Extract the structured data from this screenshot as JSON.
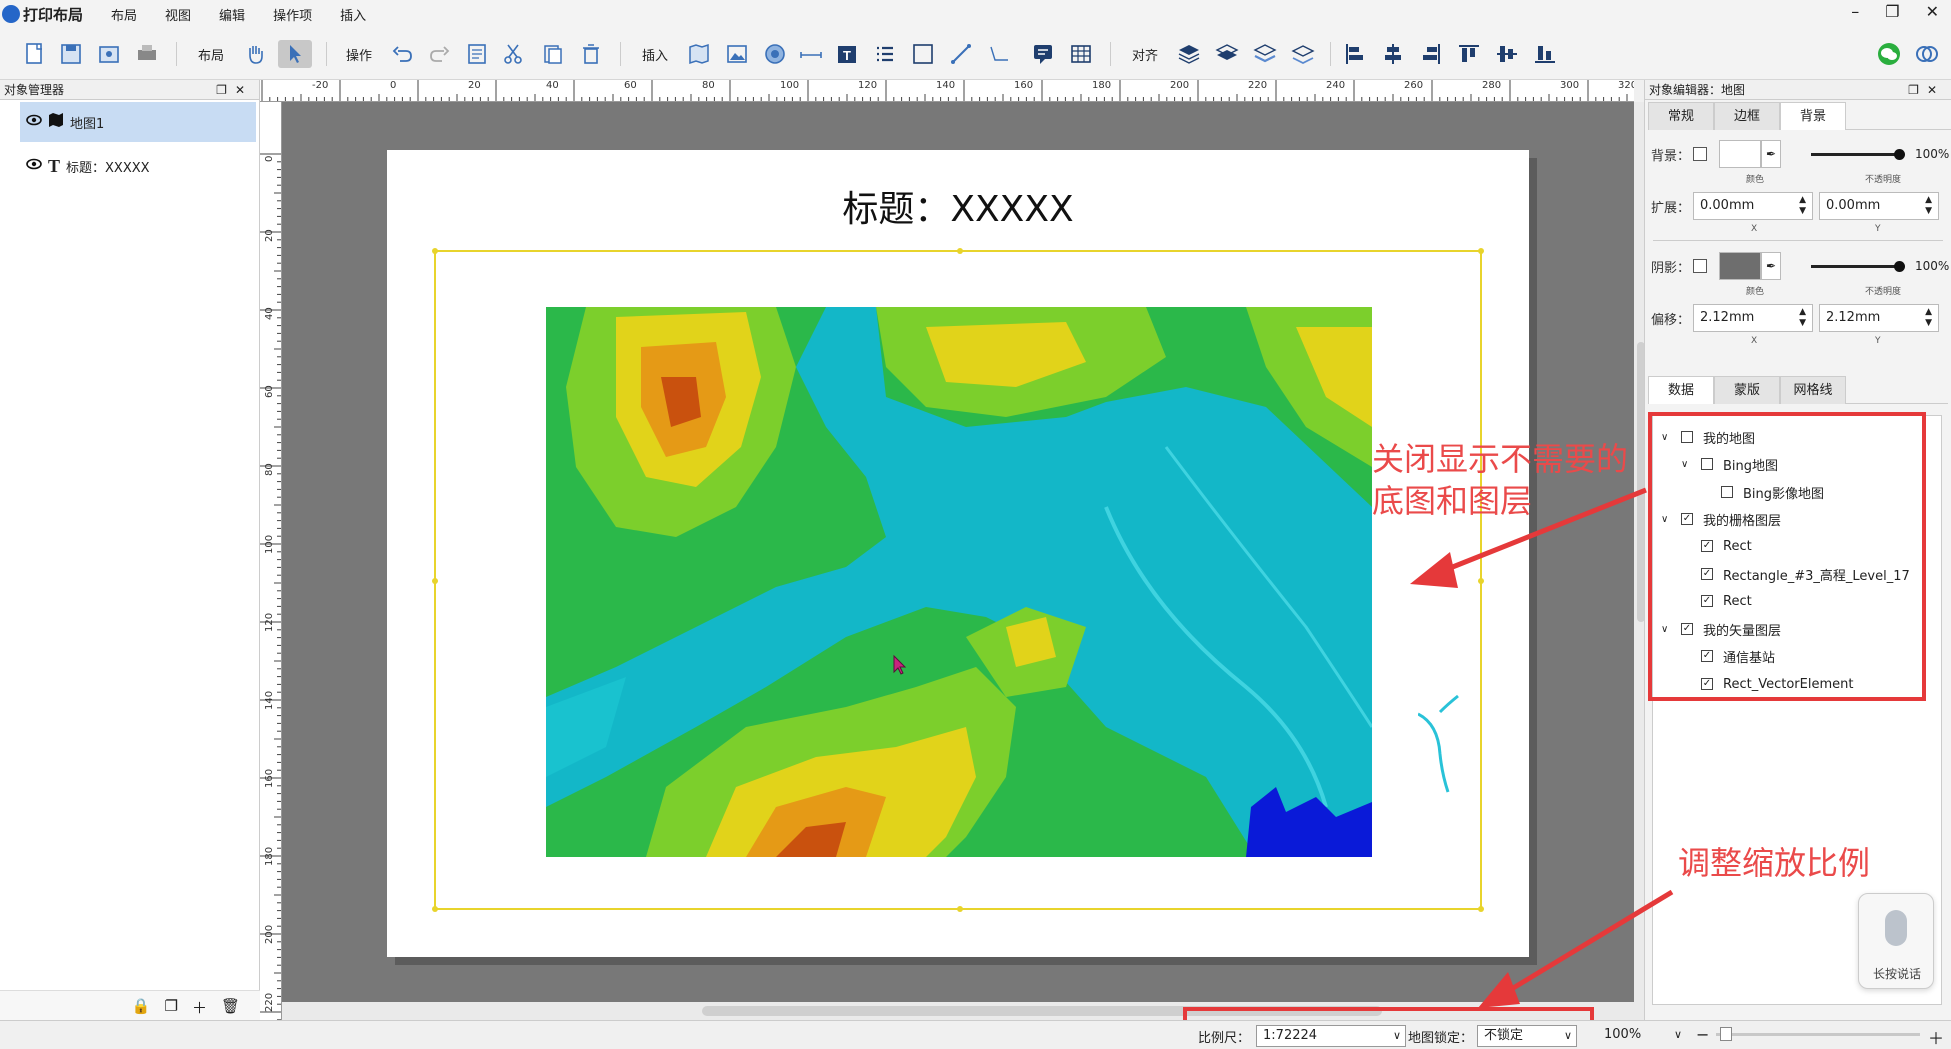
{
  "app": {
    "title": "打印布局"
  },
  "menu": [
    "布局",
    "视图",
    "编辑",
    "操作项",
    "插入"
  ],
  "toolbar": {
    "layout_label": "布局",
    "operate_label": "操作",
    "insert_label": "插入",
    "align_label": "对齐"
  },
  "object_manager": {
    "title": "对象管理器",
    "items": [
      {
        "icon": "map-object-icon",
        "label": "地图1",
        "selected": true
      },
      {
        "icon": "text-object-icon",
        "label": "标题：XXXXX",
        "selected": false
      }
    ]
  },
  "canvas": {
    "page_title": "标题：XXXXX",
    "ruler_top": [
      "-20",
      "0",
      "20",
      "40",
      "60",
      "80",
      "100",
      "120",
      "140",
      "160",
      "180",
      "200",
      "220",
      "240",
      "260",
      "280",
      "300",
      "320"
    ],
    "ruler_left": [
      "0",
      "20",
      "40",
      "60",
      "80",
      "100",
      "120",
      "140",
      "160",
      "180",
      "200",
      "220"
    ]
  },
  "object_editor": {
    "title": "对象编辑器：地图",
    "tabs": [
      "常规",
      "边框",
      "背景"
    ],
    "active_tab": "背景",
    "background_label": "背景：",
    "background_opacity": "100%",
    "color_sublabel": "颜色",
    "opacity_sublabel": "不透明度",
    "extend_label": "扩展：",
    "extend_x": "0.00mm",
    "extend_y": "0.00mm",
    "x_sublabel": "X",
    "y_sublabel": "Y",
    "shadow_label": "阴影：",
    "shadow_opacity": "100%",
    "offset_label": "偏移：",
    "offset_x": "2.12mm",
    "offset_y": "2.12mm",
    "shadow_color": "#6e6e6e"
  },
  "data_tabs": [
    "数据",
    "蒙版",
    "网格线"
  ],
  "layer_tree": [
    {
      "label": "我的地图",
      "level": 0,
      "checked": false,
      "expand": true
    },
    {
      "label": "Bing地图",
      "level": 1,
      "checked": false,
      "expand": true
    },
    {
      "label": "Bing影像地图",
      "level": 2,
      "checked": false,
      "expand": false
    },
    {
      "label": "我的栅格图层",
      "level": 0,
      "checked": true,
      "expand": true
    },
    {
      "label": "Rect",
      "level": 1,
      "checked": true,
      "expand": false
    },
    {
      "label": "Rectangle_#3_高程_Level_17",
      "level": 1,
      "checked": true,
      "expand": false
    },
    {
      "label": "Rect",
      "level": 1,
      "checked": true,
      "expand": false
    },
    {
      "label": "我的矢量图层",
      "level": 0,
      "checked": true,
      "expand": true
    },
    {
      "label": "通信基站",
      "level": 1,
      "checked": true,
      "expand": false
    },
    {
      "label": "Rect_VectorElement",
      "level": 1,
      "checked": true,
      "expand": false
    }
  ],
  "annotations": {
    "close_layers": "关闭显示不需要的\n底图和图层",
    "adjust_scale": "调整缩放比例"
  },
  "statusbar": {
    "scale_label": "比例尺：",
    "scale_value": "1:72224",
    "lock_label": "地图锁定：",
    "lock_value": "不锁定",
    "zoom_value": "100%"
  },
  "voice": {
    "label": "长按说话"
  },
  "colors": {
    "accent": "#2566c8",
    "annotation": "#e5393a",
    "frame": "#e8d42c",
    "selection": "#c8dcf3"
  }
}
